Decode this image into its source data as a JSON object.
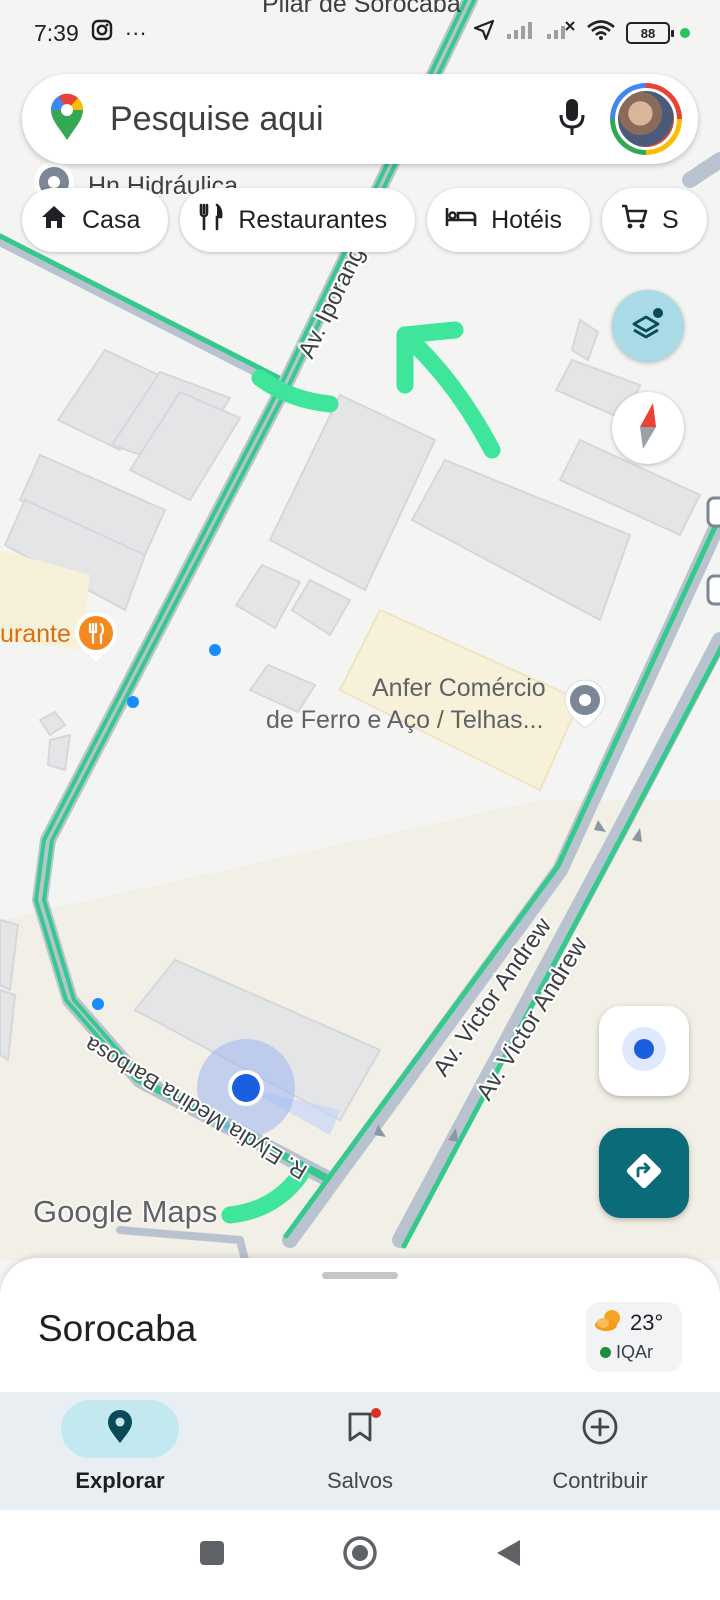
{
  "status_bar": {
    "time": "7:39",
    "overflow_dots": "···",
    "battery": "88"
  },
  "search": {
    "placeholder": "Pesquise aqui",
    "icons": [
      "google-maps-pin-icon",
      "microphone-icon",
      "account-avatar"
    ]
  },
  "chips": [
    {
      "label": "Casa",
      "icon": "home-icon"
    },
    {
      "label": "Restaurantes",
      "icon": "fork-knife-icon"
    },
    {
      "label": "Hotéis",
      "icon": "bed-icon"
    },
    {
      "label": "S",
      "icon": "cart-icon"
    }
  ],
  "map": {
    "labels": {
      "top_cut": "Pilar de Sorocaba",
      "hn_hidraulica": "Hn Hidráulica",
      "av_iporanga": "Av. Iporanga",
      "restaurante": "urante",
      "anfer_line1": "Anfer Comércio",
      "anfer_line2": "de Ferro e Aço / Telhas...",
      "av_victor_1": "Av. Victor Andrew",
      "av_victor_2": "Av. Victor Andrew",
      "elydia": "R. Elydia Medina Barbosa"
    },
    "watermark": "Google Maps"
  },
  "bottom_sheet": {
    "place": "Sorocaba",
    "temperature": "23°",
    "aqi_label": "IQAr"
  },
  "nav": [
    {
      "label": "Explorar",
      "active": true
    },
    {
      "label": "Salvos",
      "active": false
    },
    {
      "label": "Contribuir",
      "active": false
    }
  ],
  "colors": {
    "road_green": "#35c98e",
    "road_gray": "#b9c3cf",
    "annotation_green": "#3ee59a",
    "teal_button": "#0b6b78",
    "location_blue": "#1a73e8"
  }
}
